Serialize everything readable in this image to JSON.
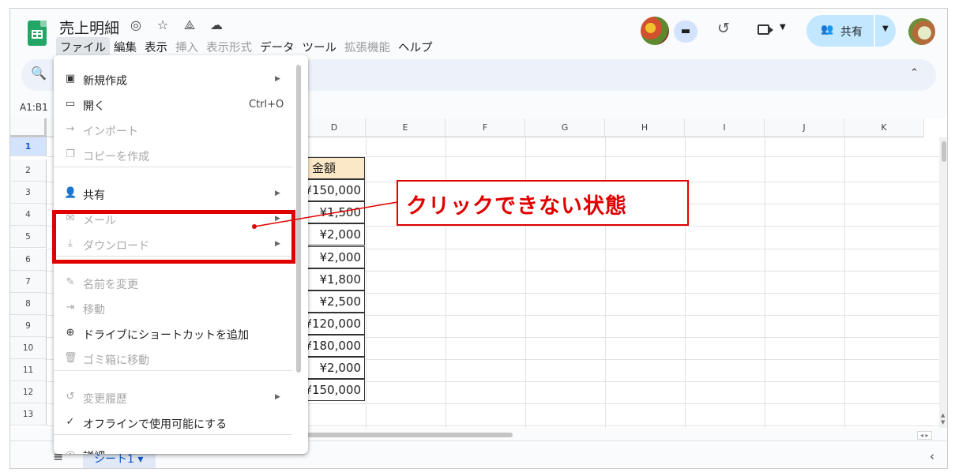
{
  "app": {
    "title": "売上明細",
    "menus": [
      {
        "label": "ファイル",
        "state": "active"
      },
      {
        "label": "編集",
        "state": "enabled"
      },
      {
        "label": "表示",
        "state": "enabled"
      },
      {
        "label": "挿入",
        "state": "disabled"
      },
      {
        "label": "表示形式",
        "state": "disabled"
      },
      {
        "label": "データ",
        "state": "enabled"
      },
      {
        "label": "ツール",
        "state": "enabled"
      },
      {
        "label": "拡張機能",
        "state": "disabled"
      },
      {
        "label": "ヘルプ",
        "state": "enabled"
      }
    ],
    "share_label": "共有",
    "name_box": "A1:B1"
  },
  "columns": [
    "D",
    "E",
    "F",
    "G",
    "H",
    "I",
    "J",
    "K"
  ],
  "rows": [
    "1",
    "2",
    "3",
    "4",
    "5",
    "6",
    "7",
    "8",
    "9",
    "10",
    "11",
    "12",
    "13"
  ],
  "amount_column": {
    "header": "金額",
    "values": [
      "¥150,000",
      "¥1,500",
      "¥2,000",
      "¥2,000",
      "¥1,800",
      "¥2,500",
      "¥120,000",
      "¥180,000",
      "¥2,000",
      "¥150,000"
    ]
  },
  "file_menu": {
    "items": [
      {
        "icon": "new-icon",
        "glyph": "▣",
        "label": "新規作成",
        "submenu": true,
        "disabled": false
      },
      {
        "icon": "folder-icon",
        "glyph": "▭",
        "label": "開く",
        "shortcut": "Ctrl+O",
        "disabled": false
      },
      {
        "icon": "import-icon",
        "glyph": "→",
        "label": "インポート",
        "disabled": true
      },
      {
        "icon": "copy-icon",
        "glyph": "❐",
        "label": "コピーを作成",
        "disabled": true
      },
      {
        "icon": "share-icon",
        "glyph": "👤",
        "label": "共有",
        "submenu": true,
        "disabled": false
      },
      {
        "icon": "mail-icon",
        "glyph": "✉",
        "label": "メール",
        "submenu": true,
        "disabled": true
      },
      {
        "icon": "download-icon",
        "glyph": "⤓",
        "label": "ダウンロード",
        "submenu": true,
        "disabled": true
      },
      {
        "icon": "rename-icon",
        "glyph": "✎",
        "label": "名前を変更",
        "disabled": true
      },
      {
        "icon": "move-icon",
        "glyph": "⇥",
        "label": "移動",
        "disabled": true
      },
      {
        "icon": "drive-shortcut-icon",
        "glyph": "⊕",
        "label": "ドライブにショートカットを追加",
        "disabled": false
      },
      {
        "icon": "trash-icon",
        "glyph": "🗑",
        "label": "ゴミ箱に移動",
        "disabled": true
      },
      {
        "icon": "history-icon",
        "glyph": "↺",
        "label": "変更履歴",
        "submenu": true,
        "disabled": true
      },
      {
        "icon": "offline-icon",
        "glyph": "✓",
        "label": "オフラインで使用可能にする",
        "disabled": false
      },
      {
        "icon": "details-icon",
        "glyph": "ⓘ",
        "label": "詳細",
        "disabled": false
      }
    ]
  },
  "annotation": {
    "callout_text": "クリックできない状態",
    "color": "#e00000"
  },
  "sheet_tab": {
    "label": "シート1"
  },
  "colors": {
    "accent": "#0b57d0",
    "share_button": "#c2e7ff",
    "header_fill": "#fbe8c6"
  }
}
